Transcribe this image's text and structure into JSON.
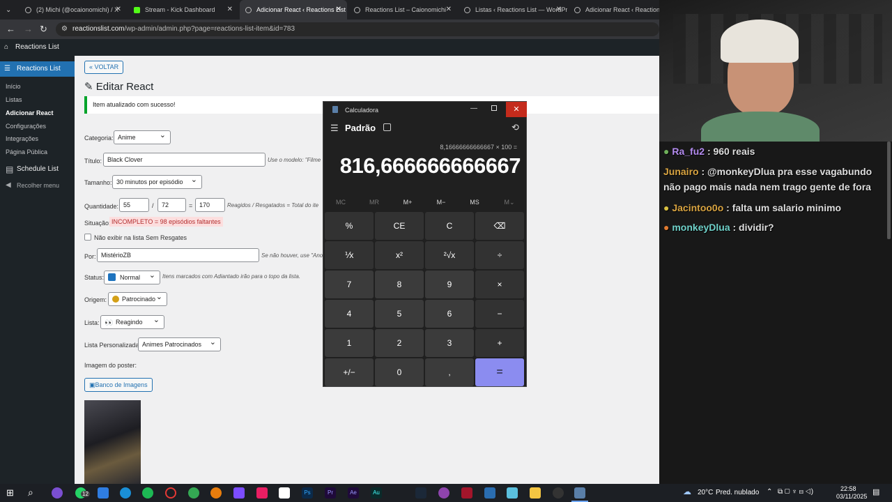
{
  "tabs": [
    {
      "label": "(2) Michi (@ocaionomichi) / X",
      "active": false
    },
    {
      "label": "Stream - Kick Dashboard",
      "active": false
    },
    {
      "label": "Adicionar React ‹ Reactions List",
      "active": true
    },
    {
      "label": "Reactions List – Caionomichi",
      "active": false
    },
    {
      "label": "Listas ‹ Reactions List — WordPress",
      "active": false
    },
    {
      "label": "Adicionar React ‹ Reactions List",
      "active": false
    }
  ],
  "url": {
    "host": "reactionslist.com",
    "path": "/wp-admin/admin.php?page=reactions-list-item&id=783"
  },
  "adminbar": {
    "site": "Reactions List"
  },
  "sidebar": {
    "current": "Reactions List",
    "items": [
      "Início",
      "Listas",
      "Adicionar React",
      "Configurações",
      "Integrações",
      "Página Pública"
    ],
    "schedule": "Schedule List",
    "collapse": "Recolher menu"
  },
  "form": {
    "back": "« VOLTAR",
    "title": "Editar React",
    "notice": "Item atualizado com sucesso!",
    "categoria_label": "Categoria:",
    "categoria": "Anime",
    "titulo_label": "Título:",
    "titulo": "Black Clover",
    "titulo_hint": "Use o modelo: \"Filme",
    "tamanho_label": "Tamanho:",
    "tamanho": "30 minutos por episódio",
    "quantidade_label": "Quantidade:",
    "q1": "55",
    "sep1": "/",
    "q2": "72",
    "sep2": "=",
    "q3": "170",
    "quantidade_hint": "Reagidos / Resgatados = Total do ite",
    "situacao_label": "Situação:",
    "situacao": "INCOMPLETO = 98 episódios faltantes",
    "checkbox": "Não exibir na lista Sem Resgates",
    "por_label": "Por:",
    "por": "MistérioZB",
    "por_hint": "Se não houver, use \"Ano",
    "status_label": "Status:",
    "status": "Normal",
    "status_hint": "Itens marcados com Adiantado irão para o topo da lista.",
    "origem_label": "Origem:",
    "origem": "Patrocinado",
    "lista_label": "Lista:",
    "lista": "Reagindo",
    "listap_label": "Lista Personalizada:",
    "listap": "Animes Patrocinados",
    "poster_label": "Imagem do poster:",
    "banco": "Banco de Imagens"
  },
  "calculator": {
    "title": "Calculadora",
    "mode": "Padrão",
    "expression": "8,16666666666667 × 100 =",
    "display": "816,666666666667",
    "memory": [
      "MC",
      "MR",
      "M+",
      "M−",
      "MS",
      "M⌄"
    ],
    "keys": [
      "%",
      "CE",
      "C",
      "⌫",
      "⅟x",
      "x²",
      "²√x",
      "÷",
      "7",
      "8",
      "9",
      "×",
      "4",
      "5",
      "6",
      "−",
      "1",
      "2",
      "3",
      "+",
      "+/−",
      "0",
      ",",
      "="
    ]
  },
  "chat": [
    {
      "user": "Ra_fu2",
      "text": ": 960 reais",
      "color": "#b48cf0"
    },
    {
      "user": "Junairo",
      "text": ": @monkeyDlua pra esse vagabundo não pago mais nada nem trago gente de fora",
      "color": "#d9a441"
    },
    {
      "user": "Jacintoo0o",
      "text": ": falta um salario minimo",
      "color": "#d9a441"
    },
    {
      "user": "monkeyDlua",
      "text": ": dividir?",
      "color": "#6fd1c9"
    }
  ],
  "taskbar": {
    "weather": "20°C",
    "weather_desc": "Pred. nublado",
    "time": "22:58",
    "date": "03/11/2025",
    "badge": "12"
  }
}
